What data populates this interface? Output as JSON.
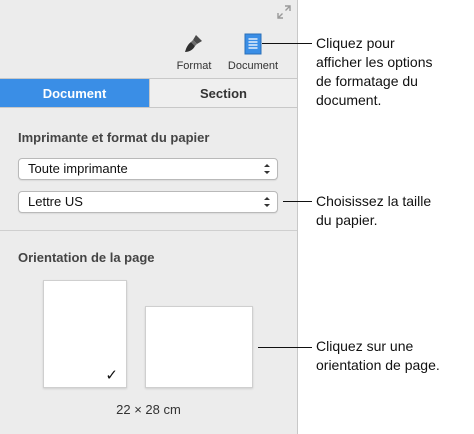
{
  "toolbar": {
    "format_label": "Format",
    "document_label": "Document"
  },
  "tabs": [
    {
      "label": "Document",
      "selected": true
    },
    {
      "label": "Section",
      "selected": false
    }
  ],
  "printer_section": {
    "title": "Imprimante et format du papier",
    "printer_value": "Toute imprimante",
    "paper_value": "Lettre US"
  },
  "orientation_section": {
    "title": "Orientation de la page",
    "selected": "portrait",
    "size_label": "22 × 28 cm"
  },
  "callouts": {
    "document_button": [
      "Cliquez pour",
      "afficher les options",
      "de formatage du",
      "document."
    ],
    "paper_size": [
      "Choisissez la taille",
      "du papier."
    ],
    "orientation": [
      "Cliquez sur une",
      "orientation de page."
    ]
  },
  "colors": {
    "accent": "#3a8ee6",
    "panel_bg": "#ececec"
  }
}
